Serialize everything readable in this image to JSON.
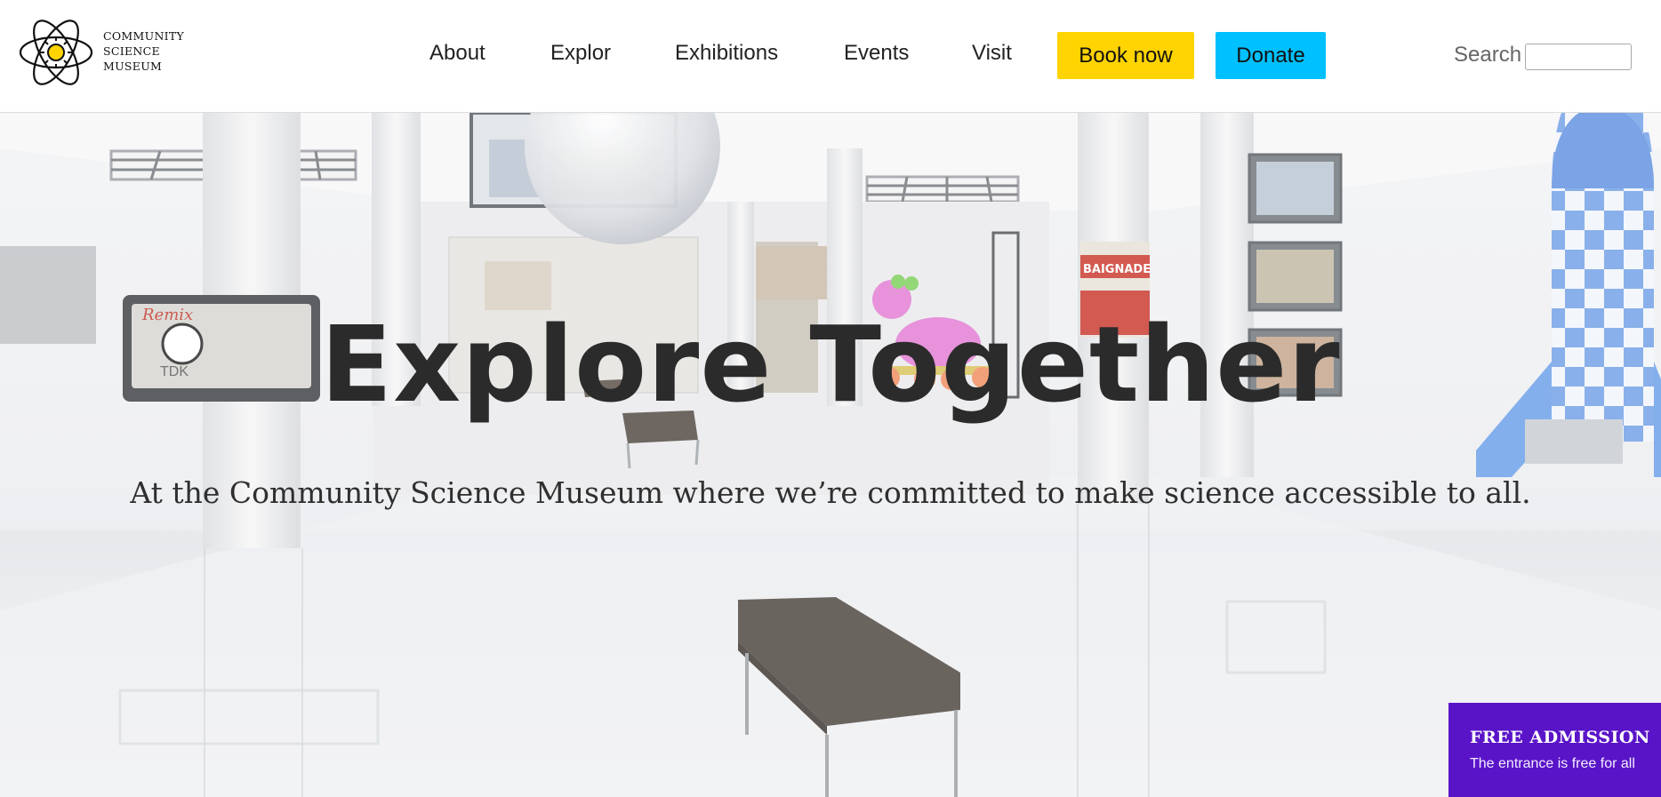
{
  "logo": {
    "line1": "COMMUNITY",
    "line2": "SCIENCE",
    "line3": "MUSEUM"
  },
  "nav": {
    "items": [
      {
        "label": "About"
      },
      {
        "label": "Explor"
      },
      {
        "label": "Exhibitions"
      },
      {
        "label": "Events"
      },
      {
        "label": "Visit"
      }
    ],
    "book_label": "Book now",
    "donate_label": "Donate"
  },
  "search": {
    "label": "Search",
    "value": ""
  },
  "hero": {
    "title": "Explore Together",
    "subtitle": "At the Community Science Museum where we’re committed to make science accessible to all.",
    "scene_signs": {
      "left_wall": "Remix",
      "left_brand": "TDK",
      "poster": "BAIGNADE"
    }
  },
  "admission": {
    "title": "FREE ADMISSION",
    "text": "The entrance is free for all"
  },
  "colors": {
    "book_button": "#ffd400",
    "donate_button": "#00c0ff",
    "admission_banner": "#5a14c8",
    "logo_sun": "#ffd400"
  },
  "icons": {
    "logo": "atom-sun-icon"
  }
}
